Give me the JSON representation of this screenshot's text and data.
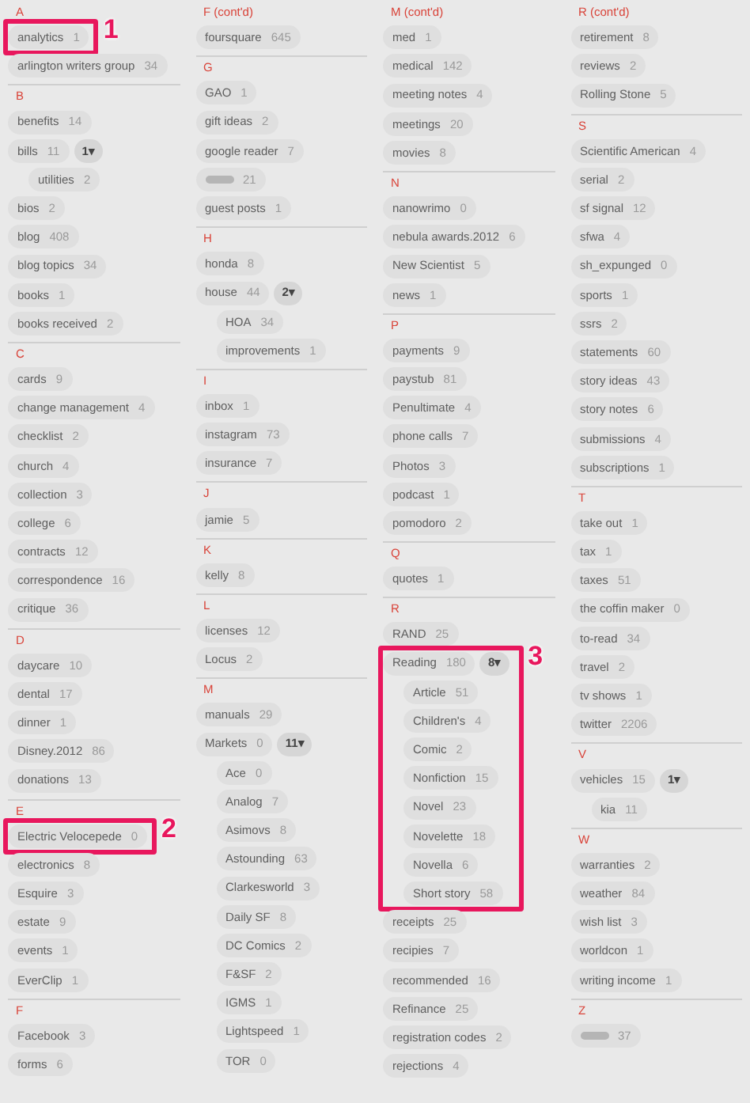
{
  "columns": [
    {
      "sections": [
        {
          "heading": "A",
          "tags": [
            {
              "name": "analytics",
              "count": "1",
              "callout": "1"
            },
            {
              "name": "arlington writers group",
              "count": "34"
            }
          ]
        },
        {
          "heading": "B",
          "tags": [
            {
              "name": "benefits",
              "count": "14"
            },
            {
              "name": "bills",
              "count": "11",
              "expand_label": "1▾",
              "children": [
                {
                  "name": "utilities",
                  "count": "2"
                }
              ]
            },
            {
              "name": "bios",
              "count": "2"
            },
            {
              "name": "blog",
              "count": "408"
            },
            {
              "name": "blog topics",
              "count": "34"
            },
            {
              "name": "books",
              "count": "1"
            },
            {
              "name": "books received",
              "count": "2"
            }
          ]
        },
        {
          "heading": "C",
          "tags": [
            {
              "name": "cards",
              "count": "9"
            },
            {
              "name": "change management",
              "count": "4"
            },
            {
              "name": "checklist",
              "count": "2"
            },
            {
              "name": "church",
              "count": "4"
            },
            {
              "name": "collection",
              "count": "3"
            },
            {
              "name": "college",
              "count": "6"
            },
            {
              "name": "contracts",
              "count": "12"
            },
            {
              "name": "correspondence",
              "count": "16"
            },
            {
              "name": "critique",
              "count": "36"
            }
          ]
        },
        {
          "heading": "D",
          "tags": [
            {
              "name": "daycare",
              "count": "10"
            },
            {
              "name": "dental",
              "count": "17"
            },
            {
              "name": "dinner",
              "count": "1"
            },
            {
              "name": "Disney.2012",
              "count": "86"
            },
            {
              "name": "donations",
              "count": "13"
            }
          ]
        },
        {
          "heading": "E",
          "tags": [
            {
              "name": "Electric Velocepede",
              "count": "0",
              "callout": "2"
            },
            {
              "name": "electronics",
              "count": "8"
            },
            {
              "name": "Esquire",
              "count": "3"
            },
            {
              "name": "estate",
              "count": "9"
            },
            {
              "name": "events",
              "count": "1"
            },
            {
              "name": "EverClip",
              "count": "1"
            }
          ]
        },
        {
          "heading": "F",
          "tags": [
            {
              "name": "Facebook",
              "count": "3"
            },
            {
              "name": "forms",
              "count": "6"
            }
          ]
        }
      ]
    },
    {
      "sections": [
        {
          "heading": "F (cont'd)",
          "tags": [
            {
              "name": "foursquare",
              "count": "645"
            }
          ]
        },
        {
          "heading": "G",
          "tags": [
            {
              "name": "GAO",
              "count": "1"
            },
            {
              "name": "gift ideas",
              "count": "2"
            },
            {
              "name": "google reader",
              "count": "7"
            },
            {
              "redacted": true,
              "count": "21"
            },
            {
              "name": "guest posts",
              "count": "1"
            }
          ]
        },
        {
          "heading": "H",
          "tags": [
            {
              "name": "honda",
              "count": "8"
            },
            {
              "name": "house",
              "count": "44",
              "expand_label": "2▾",
              "children": [
                {
                  "name": "HOA",
                  "count": "34"
                },
                {
                  "name": "improvements",
                  "count": "1"
                }
              ]
            }
          ]
        },
        {
          "heading": "I",
          "tags": [
            {
              "name": "inbox",
              "count": "1"
            },
            {
              "name": "instagram",
              "count": "73"
            },
            {
              "name": "insurance",
              "count": "7"
            }
          ]
        },
        {
          "heading": "J",
          "tags": [
            {
              "name": "jamie",
              "count": "5"
            }
          ]
        },
        {
          "heading": "K",
          "tags": [
            {
              "name": "kelly",
              "count": "8"
            }
          ]
        },
        {
          "heading": "L",
          "tags": [
            {
              "name": "licenses",
              "count": "12"
            },
            {
              "name": "Locus",
              "count": "2"
            }
          ]
        },
        {
          "heading": "M",
          "tags": [
            {
              "name": "manuals",
              "count": "29"
            },
            {
              "name": "Markets",
              "count": "0",
              "expand_label": "11▾",
              "children": [
                {
                  "name": "Ace",
                  "count": "0"
                },
                {
                  "name": "Analog",
                  "count": "7"
                },
                {
                  "name": "Asimovs",
                  "count": "8"
                },
                {
                  "name": "Astounding",
                  "count": "63"
                },
                {
                  "name": "Clarkesworld",
                  "count": "3"
                },
                {
                  "name": "Daily SF",
                  "count": "8"
                },
                {
                  "name": "DC Comics",
                  "count": "2"
                },
                {
                  "name": "F&SF",
                  "count": "2"
                },
                {
                  "name": "IGMS",
                  "count": "1"
                },
                {
                  "name": "Lightspeed",
                  "count": "1"
                },
                {
                  "name": "TOR",
                  "count": "0"
                }
              ]
            }
          ]
        }
      ]
    },
    {
      "sections": [
        {
          "heading": "M (cont'd)",
          "tags": [
            {
              "name": "med",
              "count": "1"
            },
            {
              "name": "medical",
              "count": "142"
            },
            {
              "name": "meeting notes",
              "count": "4"
            },
            {
              "name": "meetings",
              "count": "20"
            },
            {
              "name": "movies",
              "count": "8"
            }
          ]
        },
        {
          "heading": "N",
          "tags": [
            {
              "name": "nanowrimo",
              "count": "0"
            },
            {
              "name": "nebula awards.2012",
              "count": "6"
            },
            {
              "name": "New Scientist",
              "count": "5"
            },
            {
              "name": "news",
              "count": "1"
            }
          ]
        },
        {
          "heading": "P",
          "tags": [
            {
              "name": "payments",
              "count": "9"
            },
            {
              "name": "paystub",
              "count": "81"
            },
            {
              "name": "Penultimate",
              "count": "4"
            },
            {
              "name": "phone calls",
              "count": "7"
            },
            {
              "name": "Photos",
              "count": "3"
            },
            {
              "name": "podcast",
              "count": "1"
            },
            {
              "name": "pomodoro",
              "count": "2"
            }
          ]
        },
        {
          "heading": "Q",
          "tags": [
            {
              "name": "quotes",
              "count": "1"
            }
          ]
        },
        {
          "heading": "R",
          "tags": [
            {
              "name": "RAND",
              "count": "25"
            },
            {
              "name": "Reading",
              "count": "180",
              "expand_label": "8▾",
              "callout": "3",
              "children": [
                {
                  "name": "Article",
                  "count": "51"
                },
                {
                  "name": "Children's",
                  "count": "4"
                },
                {
                  "name": "Comic",
                  "count": "2"
                },
                {
                  "name": "Nonfiction",
                  "count": "15"
                },
                {
                  "name": "Novel",
                  "count": "23"
                },
                {
                  "name": "Novelette",
                  "count": "18"
                },
                {
                  "name": "Novella",
                  "count": "6"
                },
                {
                  "name": "Short story",
                  "count": "58"
                }
              ]
            },
            {
              "name": "receipts",
              "count": "25"
            },
            {
              "name": "recipies",
              "count": "7"
            },
            {
              "name": "recommended",
              "count": "16"
            },
            {
              "name": "Refinance",
              "count": "25"
            },
            {
              "name": "registration codes",
              "count": "2"
            },
            {
              "name": "rejections",
              "count": "4"
            }
          ]
        }
      ]
    },
    {
      "sections": [
        {
          "heading": "R (cont'd)",
          "tags": [
            {
              "name": "retirement",
              "count": "8"
            },
            {
              "name": "reviews",
              "count": "2"
            },
            {
              "name": "Rolling Stone",
              "count": "5"
            }
          ]
        },
        {
          "heading": "S",
          "tags": [
            {
              "name": "Scientific American",
              "count": "4"
            },
            {
              "name": "serial",
              "count": "2"
            },
            {
              "name": "sf signal",
              "count": "12"
            },
            {
              "name": "sfwa",
              "count": "4"
            },
            {
              "name": "sh_expunged",
              "count": "0"
            },
            {
              "name": "sports",
              "count": "1"
            },
            {
              "name": "ssrs",
              "count": "2"
            },
            {
              "name": "statements",
              "count": "60"
            },
            {
              "name": "story ideas",
              "count": "43"
            },
            {
              "name": "story notes",
              "count": "6"
            },
            {
              "name": "submissions",
              "count": "4"
            },
            {
              "name": "subscriptions",
              "count": "1"
            }
          ]
        },
        {
          "heading": "T",
          "tags": [
            {
              "name": "take out",
              "count": "1"
            },
            {
              "name": "tax",
              "count": "1"
            },
            {
              "name": "taxes",
              "count": "51"
            },
            {
              "name": "the coffin maker",
              "count": "0"
            },
            {
              "name": "to-read",
              "count": "34"
            },
            {
              "name": "travel",
              "count": "2"
            },
            {
              "name": "tv shows",
              "count": "1"
            },
            {
              "name": "twitter",
              "count": "2206"
            }
          ]
        },
        {
          "heading": "V",
          "tags": [
            {
              "name": "vehicles",
              "count": "15",
              "expand_label": "1▾",
              "children": [
                {
                  "name": "kia",
                  "count": "11"
                }
              ]
            }
          ]
        },
        {
          "heading": "W",
          "tags": [
            {
              "name": "warranties",
              "count": "2"
            },
            {
              "name": "weather",
              "count": "84"
            },
            {
              "name": "wish list",
              "count": "3"
            },
            {
              "name": "worldcon",
              "count": "1"
            },
            {
              "name": "writing income",
              "count": "1"
            }
          ]
        },
        {
          "heading": "Z",
          "tags": [
            {
              "redacted": true,
              "count": "37"
            }
          ]
        }
      ]
    }
  ]
}
